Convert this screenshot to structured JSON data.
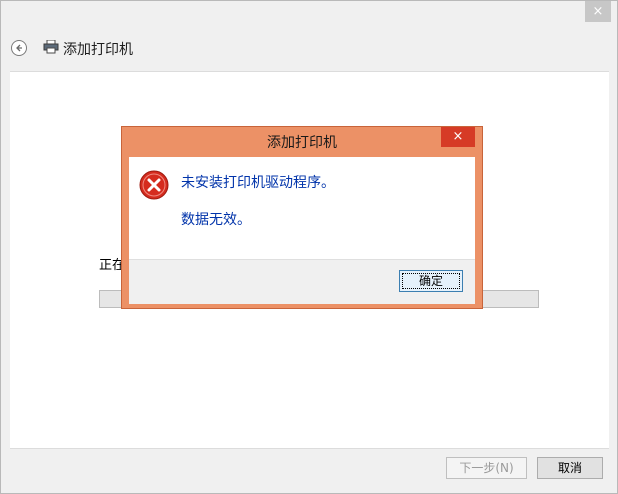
{
  "window": {
    "close_glyph": "×",
    "header_title": "添加打印机",
    "back_icon": "back-arrow-icon",
    "printer_icon": "printer-icon"
  },
  "main": {
    "status_text": "正在",
    "progress_fraction": 0
  },
  "footer": {
    "next_label": "下一步(N)",
    "cancel_label": "取消"
  },
  "dialog": {
    "title": "添加打印机",
    "close_glyph": "×",
    "icon": "error-icon",
    "message_line1": "未安装打印机驱动程序。",
    "message_line2": "数据无效。",
    "ok_label": "确定"
  },
  "colors": {
    "dialog_frame": "#ec9166",
    "dialog_close": "#d63b26",
    "message_text": "#0033aa",
    "error_red": "#d52b1e"
  }
}
